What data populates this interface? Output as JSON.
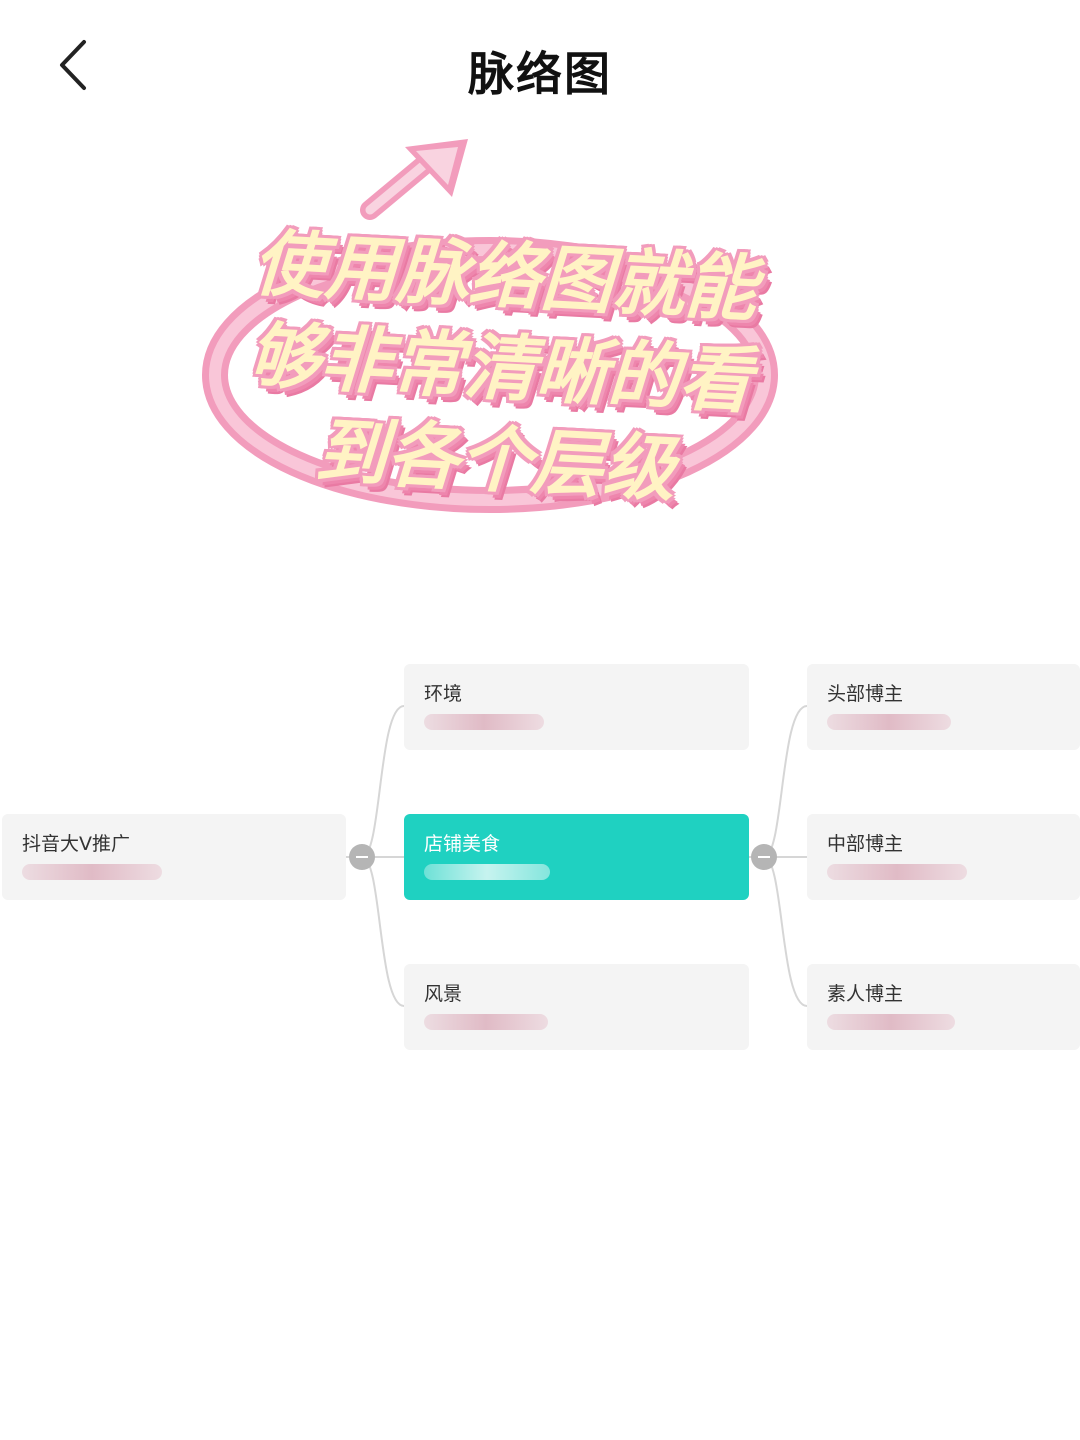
{
  "header": {
    "title": "脉络图",
    "back_icon": "chevron-left-icon"
  },
  "overlay": {
    "lines": [
      "使用脉络图就能",
      "够非常清晰的看",
      "到各个层级"
    ],
    "text_color": "#fff3c4",
    "outline_color": "#f29cbc",
    "arrow_icon": "arrow-up-right-icon"
  },
  "mindmap": {
    "root": {
      "title": "抖音大V推广"
    },
    "level1": [
      {
        "title": "环境"
      },
      {
        "title": "店铺美食",
        "selected": true
      },
      {
        "title": "风景"
      }
    ],
    "level2": [
      {
        "title": "头部博主"
      },
      {
        "title": "中部博主"
      },
      {
        "title": "素人博主"
      }
    ],
    "accent_color": "#1fd1c1"
  }
}
